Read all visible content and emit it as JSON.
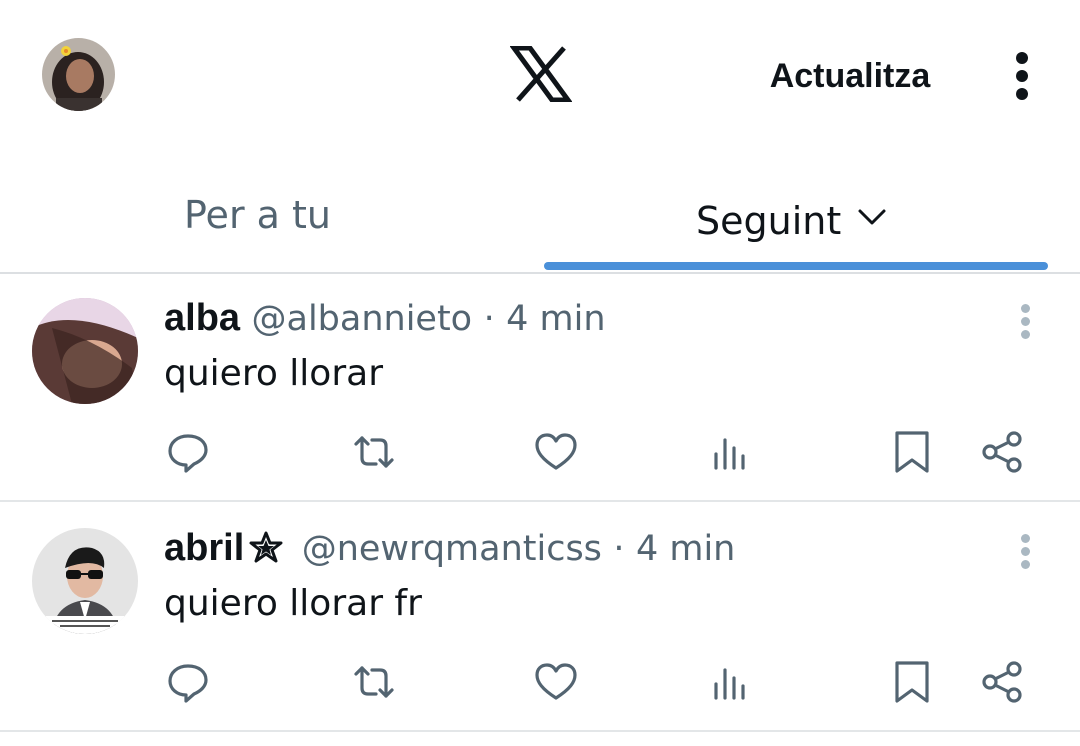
{
  "topbar": {
    "refresh_label": "Actualitza",
    "logo_icon": "x-logo-icon",
    "menu_icon": "more-vertical-icon",
    "avatar_icon": "profile-avatar"
  },
  "tabs": [
    {
      "label": "Per a tu",
      "active": false
    },
    {
      "label": "Seguint",
      "active": true,
      "icon": "chevron-down-icon"
    }
  ],
  "colors": {
    "text": "#0f1419",
    "muted": "#536471",
    "accent": "#4a90d9",
    "divider": "#e3e6e8"
  },
  "posts": [
    {
      "name": "alba",
      "handle": "@albannieto",
      "dot": "·",
      "time": "4 min",
      "text": "quiero llorar",
      "badge": null,
      "actions": [
        "reply-icon",
        "repost-icon",
        "like-icon",
        "views-icon",
        "bookmark-icon",
        "share-icon"
      ]
    },
    {
      "name": "abril",
      "handle": "@newrqmanticss",
      "dot": "·",
      "time": "4 min",
      "text": "quiero llorar fr",
      "badge": "star-icon",
      "actions": [
        "reply-icon",
        "repost-icon",
        "like-icon",
        "views-icon",
        "bookmark-icon",
        "share-icon"
      ]
    }
  ]
}
